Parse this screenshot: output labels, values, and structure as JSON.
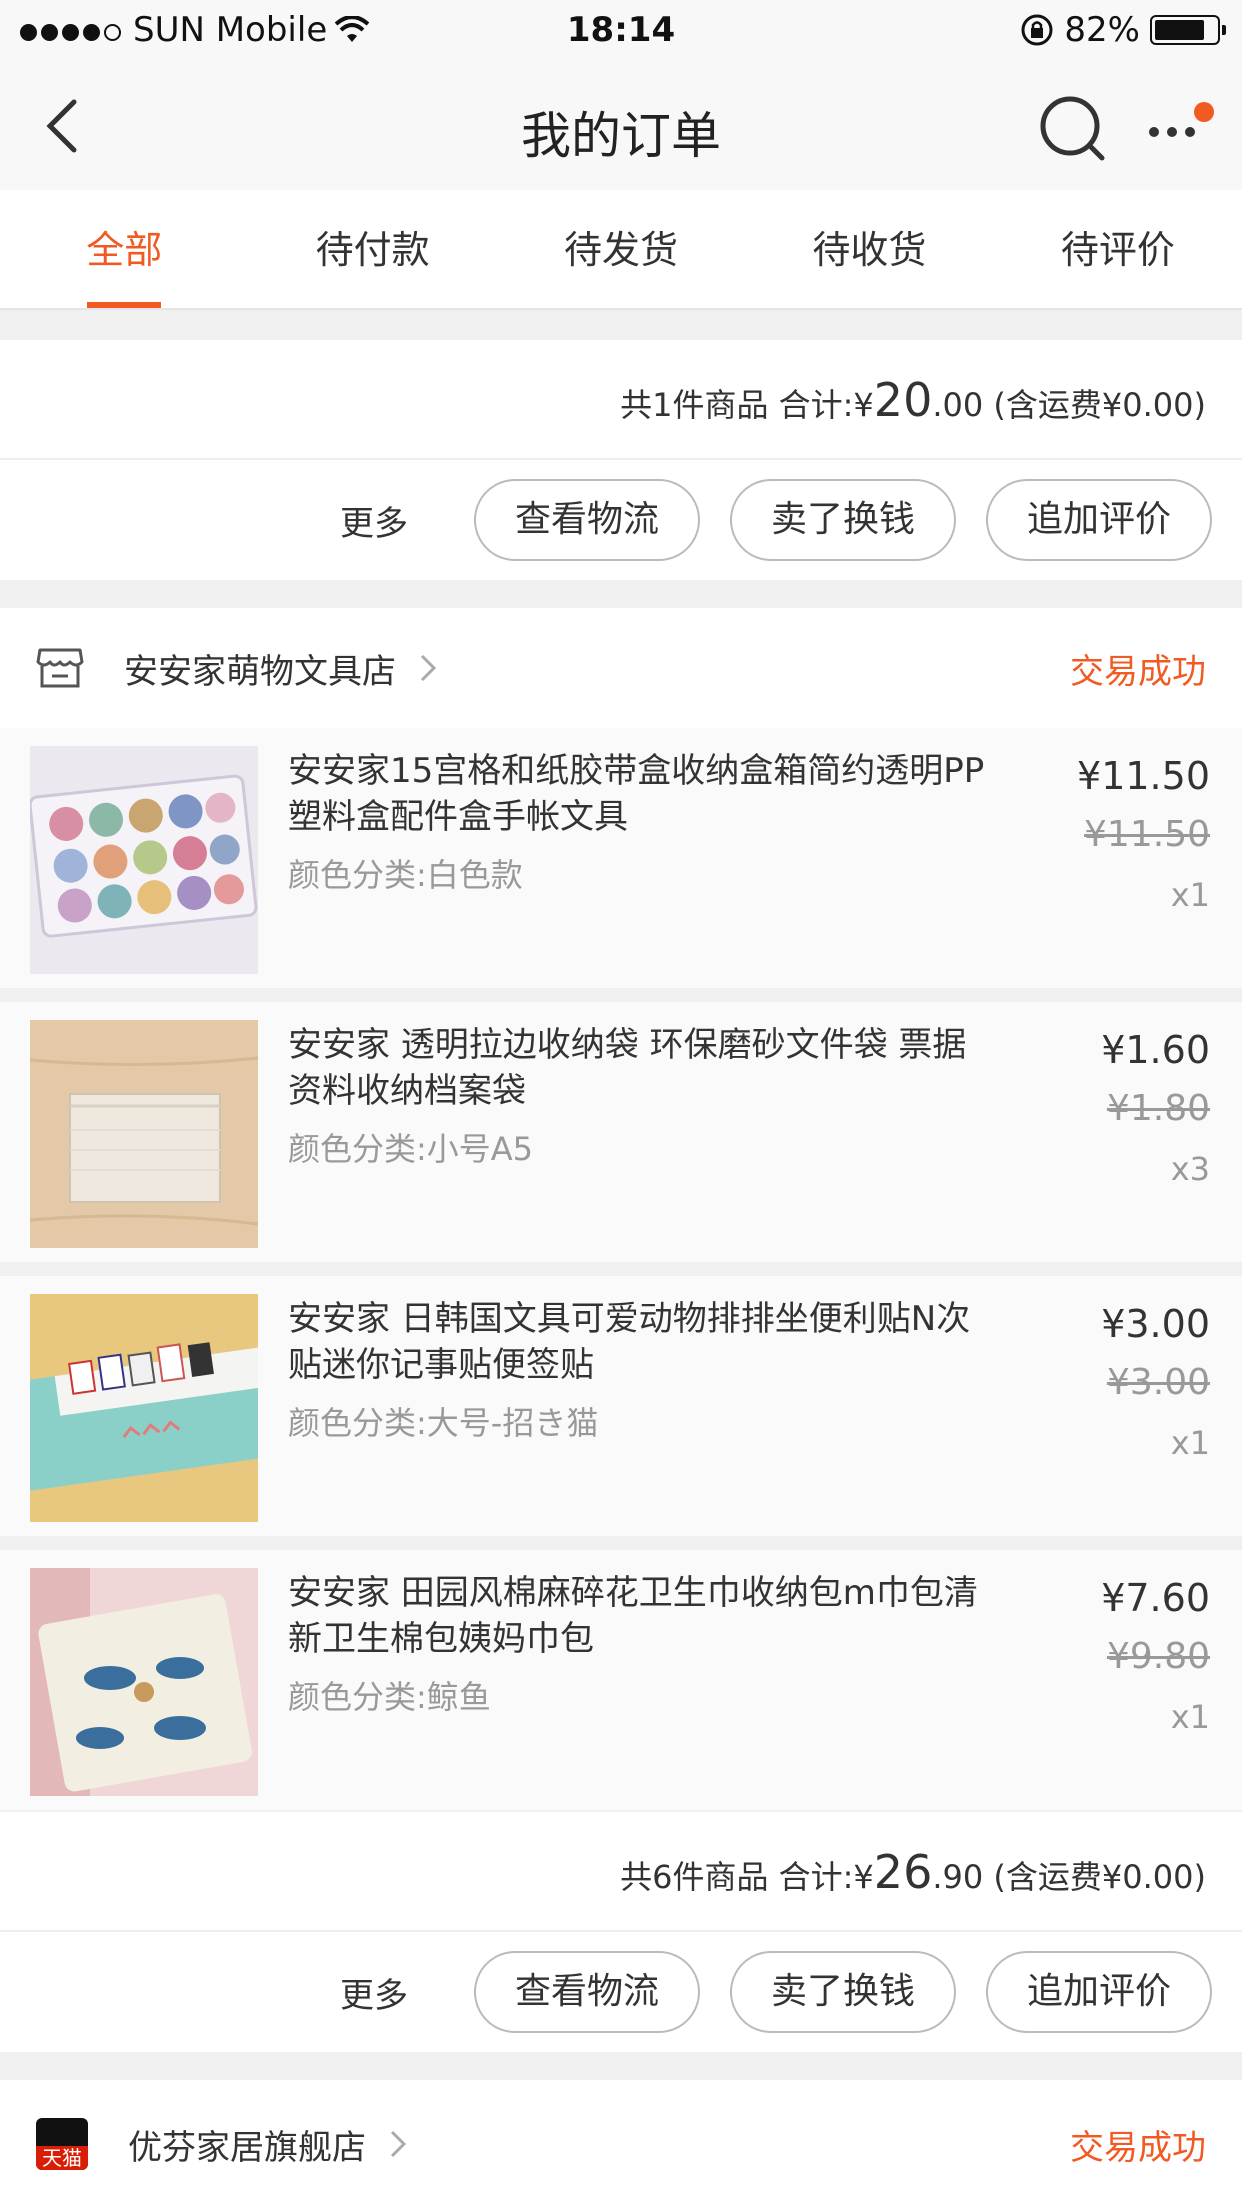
{
  "status_bar": {
    "carrier": "SUN Mobile",
    "time": "18:14",
    "battery": "82%"
  },
  "nav": {
    "title": "我的订单"
  },
  "tabs": [
    "全部",
    "待付款",
    "待发货",
    "待收货",
    "待评价"
  ],
  "order1": {
    "summary_prefix": "共1件商品 合计:¥",
    "total_int": "20",
    "total_dec": ".00",
    "shipping": " (含运费¥0.00)",
    "more": "更多",
    "buttons": [
      "查看物流",
      "卖了换钱",
      "追加评价"
    ]
  },
  "order2": {
    "shop_name": "安安家萌物文具店",
    "status": "交易成功",
    "items": [
      {
        "name": "安安家15宫格和纸胶带盒收纳盒箱简约透明PP塑料盒配件盒手帐文具",
        "spec": "颜色分类:白色款",
        "price": "¥11.50",
        "orig_price": "¥11.50",
        "qty": "x1"
      },
      {
        "name": "安安家 透明拉边收纳袋 环保磨砂文件袋 票据资料收纳档案袋",
        "spec": "颜色分类:小号A5",
        "price": "¥1.60",
        "orig_price": "¥1.80",
        "qty": "x3"
      },
      {
        "name": "安安家 日韩国文具可爱动物排排坐便利贴N次贴迷你记事贴便签贴",
        "spec": "颜色分类:大号-招き猫",
        "price": "¥3.00",
        "orig_price": "¥3.00",
        "qty": "x1"
      },
      {
        "name": "安安家 田园风棉麻碎花卫生巾收纳包m巾包清新卫生棉包姨妈巾包",
        "spec": "颜色分类:鲸鱼",
        "price": "¥7.60",
        "orig_price": "¥9.80",
        "qty": "x1"
      }
    ],
    "summary_prefix": "共6件商品 合计:¥",
    "total_int": "26",
    "total_dec": ".90",
    "shipping": " (含运费¥0.00)",
    "more": "更多",
    "buttons": [
      "查看物流",
      "卖了换钱",
      "追加评价"
    ]
  },
  "order3": {
    "shop_name": "优芬家居旗舰店",
    "status": "交易成功",
    "badge": "天猫"
  },
  "colors": {
    "accent": "#f15a22"
  }
}
